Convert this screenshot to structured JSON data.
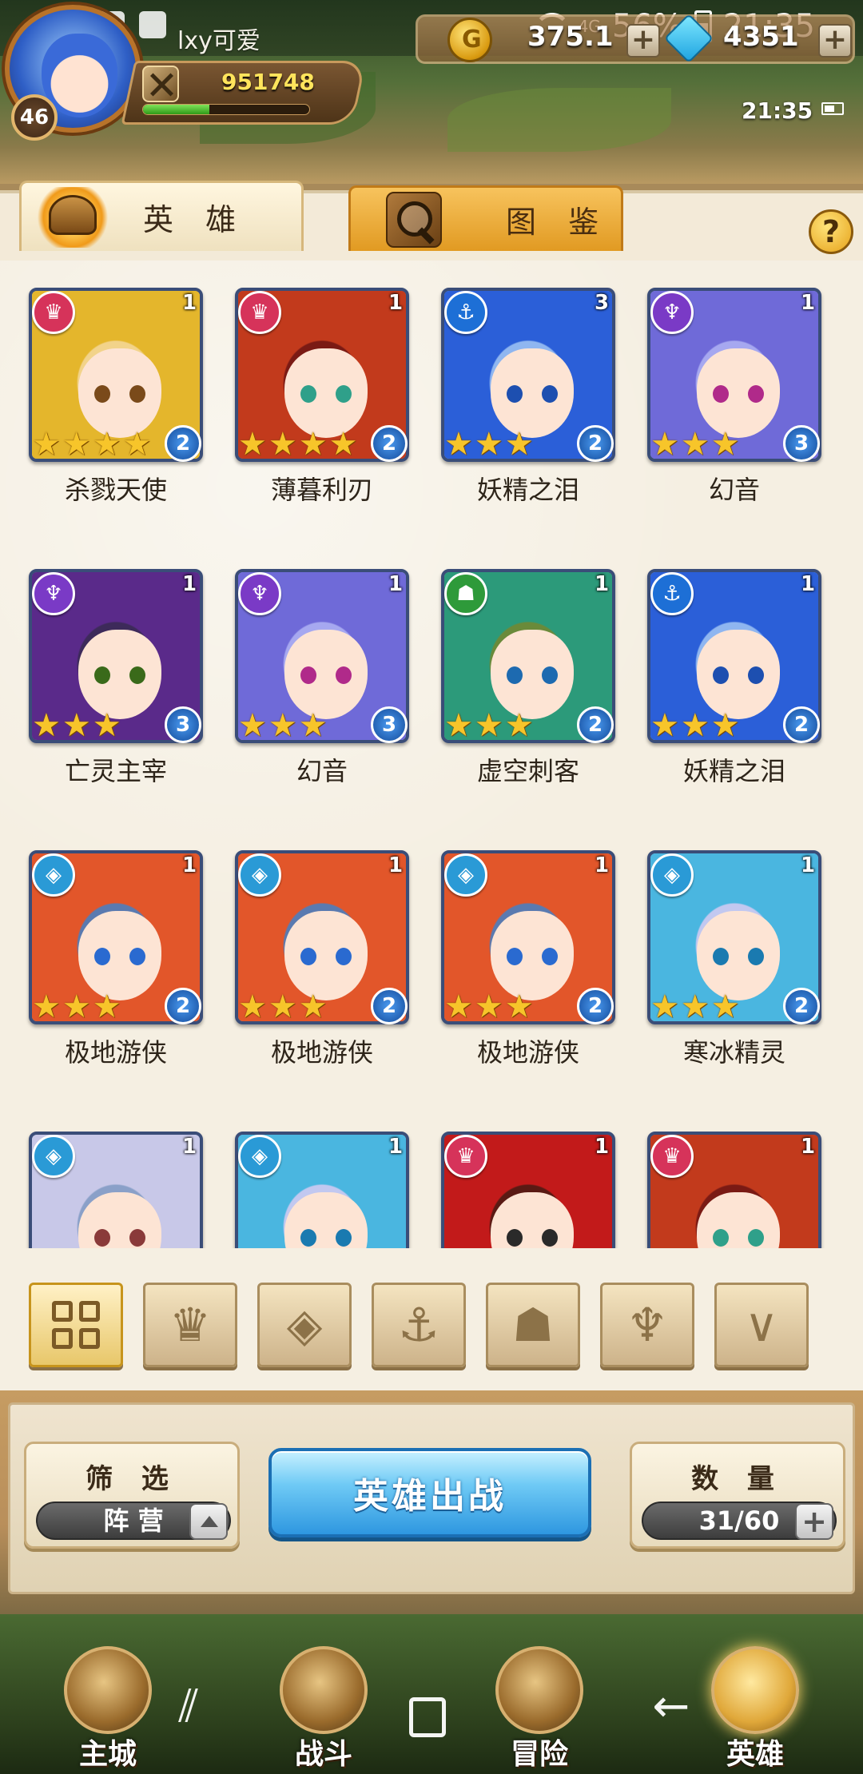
{
  "status_bar": {
    "player_name": "lxy可爱",
    "network": "4G",
    "battery_percent": "56%",
    "time": "21:35"
  },
  "hud": {
    "player_level": "46",
    "combat_power": "951748",
    "exp_fraction": 0.4,
    "gold": "375.1",
    "gems": "4351",
    "game_clock": "21:35"
  },
  "tabs": {
    "heroes_label": "英 雄",
    "codex_label": "图 鉴"
  },
  "help_label": "?",
  "heroes": [
    {
      "name": "杀戮天使",
      "faction": "fire",
      "faction_color": "#d6335a",
      "copies": "1",
      "stars": 4,
      "quality": "2",
      "hair_color": "#e4b62c",
      "eye_color": "#7a4a1a",
      "bg_color": "#f2d38a"
    },
    {
      "name": "薄暮利刃",
      "faction": "fire",
      "faction_color": "#d6335a",
      "copies": "1",
      "stars": 4,
      "quality": "2",
      "hair_color": "#c23a1c",
      "eye_color": "#2fa08a",
      "bg_color": "#7a1a14"
    },
    {
      "name": "妖精之泪",
      "faction": "anchor",
      "faction_color": "#1d6fd6",
      "copies": "3",
      "stars": 3,
      "quality": "2",
      "hair_color": "#2b5fd8",
      "eye_color": "#1d4fb0",
      "bg_color": "#8fb6f0"
    },
    {
      "name": "幻音",
      "faction": "horn",
      "faction_color": "#7a3ac6",
      "copies": "1",
      "stars": 3,
      "quality": "3",
      "hair_color": "#6f6ad8",
      "eye_color": "#b02a8a",
      "bg_color": "#a6a8f0"
    },
    {
      "name": "亡灵主宰",
      "faction": "horn",
      "faction_color": "#7a3ac6",
      "copies": "1",
      "stars": 3,
      "quality": "3",
      "hair_color": "#5a2a8a",
      "eye_color": "#3a6a1a",
      "bg_color": "#3d2a5a"
    },
    {
      "name": "幻音",
      "faction": "horn",
      "faction_color": "#7a3ac6",
      "copies": "1",
      "stars": 3,
      "quality": "3",
      "hair_color": "#6f6ad8",
      "eye_color": "#b02a8a",
      "bg_color": "#a6a8f0"
    },
    {
      "name": "虚空刺客",
      "faction": "beast",
      "faction_color": "#2e9a3a",
      "copies": "1",
      "stars": 3,
      "quality": "2",
      "hair_color": "#2c9a7a",
      "eye_color": "#1d6ab0",
      "bg_color": "#6a8a3a"
    },
    {
      "name": "妖精之泪",
      "faction": "anchor",
      "faction_color": "#1d6fd6",
      "copies": "1",
      "stars": 3,
      "quality": "2",
      "hair_color": "#2b5fd8",
      "eye_color": "#1d4fb0",
      "bg_color": "#8fb6f0"
    },
    {
      "name": "极地游侠",
      "faction": "ice",
      "faction_color": "#2a9ad6",
      "copies": "1",
      "stars": 3,
      "quality": "2",
      "hair_color": "#e2562a",
      "eye_color": "#2a6ad0",
      "bg_color": "#5a7ab0"
    },
    {
      "name": "极地游侠",
      "faction": "ice",
      "faction_color": "#2a9ad6",
      "copies": "1",
      "stars": 3,
      "quality": "2",
      "hair_color": "#e2562a",
      "eye_color": "#2a6ad0",
      "bg_color": "#5a7ab0"
    },
    {
      "name": "极地游侠",
      "faction": "ice",
      "faction_color": "#2a9ad6",
      "copies": "1",
      "stars": 3,
      "quality": "2",
      "hair_color": "#e2562a",
      "eye_color": "#2a6ad0",
      "bg_color": "#5a7ab0"
    },
    {
      "name": "寒冰精灵",
      "faction": "ice",
      "faction_color": "#2a9ad6",
      "copies": "1",
      "stars": 3,
      "quality": "2",
      "hair_color": "#4ab6e0",
      "eye_color": "#1a7ab0",
      "bg_color": "#c2c8f0"
    },
    {
      "name": "",
      "faction": "ice",
      "faction_color": "#2a9ad6",
      "copies": "1",
      "stars": 0,
      "quality": "",
      "hair_color": "#c8c8e8",
      "eye_color": "#8a3a3a",
      "bg_color": "#8aa0c8"
    },
    {
      "name": "",
      "faction": "ice",
      "faction_color": "#2a9ad6",
      "copies": "1",
      "stars": 0,
      "quality": "",
      "hair_color": "#4ab6e0",
      "eye_color": "#1a7ab0",
      "bg_color": "#c2c8f0"
    },
    {
      "name": "",
      "faction": "fire",
      "faction_color": "#d6335a",
      "copies": "1",
      "stars": 0,
      "quality": "",
      "hair_color": "#c21a1a",
      "eye_color": "#2a2a2a",
      "bg_color": "#5a1a14"
    },
    {
      "name": "",
      "faction": "fire",
      "faction_color": "#d6335a",
      "copies": "1",
      "stars": 0,
      "quality": "",
      "hair_color": "#c23a1c",
      "eye_color": "#2fa08a",
      "bg_color": "#7a1a14"
    }
  ],
  "faction_filters": [
    {
      "name": "all",
      "glyph": ""
    },
    {
      "name": "fire",
      "glyph": "♛"
    },
    {
      "name": "ice",
      "glyph": "◈"
    },
    {
      "name": "anchor",
      "glyph": "⚓"
    },
    {
      "name": "beast",
      "glyph": "☗"
    },
    {
      "name": "horn",
      "glyph": "♆"
    },
    {
      "name": "wing",
      "glyph": "∨"
    }
  ],
  "controls": {
    "filter_title": "筛 选",
    "filter_value": "阵 营",
    "deploy_label": "英雄出战",
    "count_title": "数 量",
    "count_value": "31/60"
  },
  "bottom_nav": [
    {
      "key": "main_city",
      "label": "主城"
    },
    {
      "key": "battle",
      "label": "战斗"
    },
    {
      "key": "adventure",
      "label": "冒险"
    },
    {
      "key": "heroes",
      "label": "英雄"
    }
  ],
  "system_nav": {
    "recent": "⫽",
    "home": "",
    "back": "←"
  }
}
